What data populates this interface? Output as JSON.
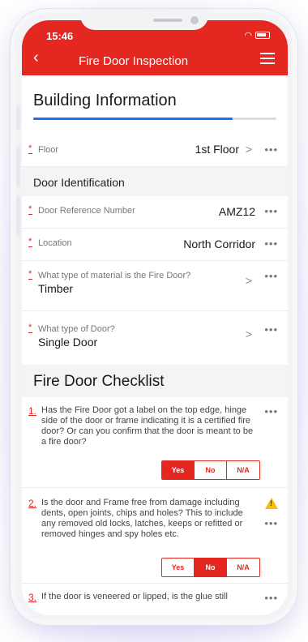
{
  "status_bar": {
    "time": "15:46"
  },
  "app_bar": {
    "title": "Fire Door Inspection",
    "back_icon": "chevron-left-icon",
    "menu_icon": "hamburger-menu-icon"
  },
  "building": {
    "title": "Building Information",
    "progress": 0.82,
    "floor_label": "Floor",
    "floor_value": "1st Floor"
  },
  "door_id": {
    "heading": "Door Identification",
    "ref_label": "Door Reference Number",
    "ref_value": "AMZ12",
    "location_label": "Location",
    "location_value": "North Corridor",
    "material_label": "What type of material is the Fire Door?",
    "material_value": "Timber",
    "type_label": "What type of Door?",
    "type_value": "Single Door"
  },
  "checklist": {
    "title": "Fire Door Checklist",
    "options": [
      "Yes",
      "No",
      "N/A"
    ],
    "questions": [
      {
        "num": "1.",
        "text": "Has the Fire Door got a label on the top edge, hinge side of the door or frame indicating it is a certified fire door? Or can you confirm that the door is meant to be a fire door?",
        "selected": "Yes"
      },
      {
        "num": "2.",
        "text": "Is the door and Frame free from damage including dents, open joints, chips and holes? This to include any removed old locks, latches, keeps or refitted or removed hinges and spy holes etc.",
        "selected": "No",
        "warning": true
      },
      {
        "num": "3.",
        "text": "If the door is veneered or lipped, is the glue still"
      }
    ]
  },
  "more_label": "•••",
  "chevron": ">"
}
